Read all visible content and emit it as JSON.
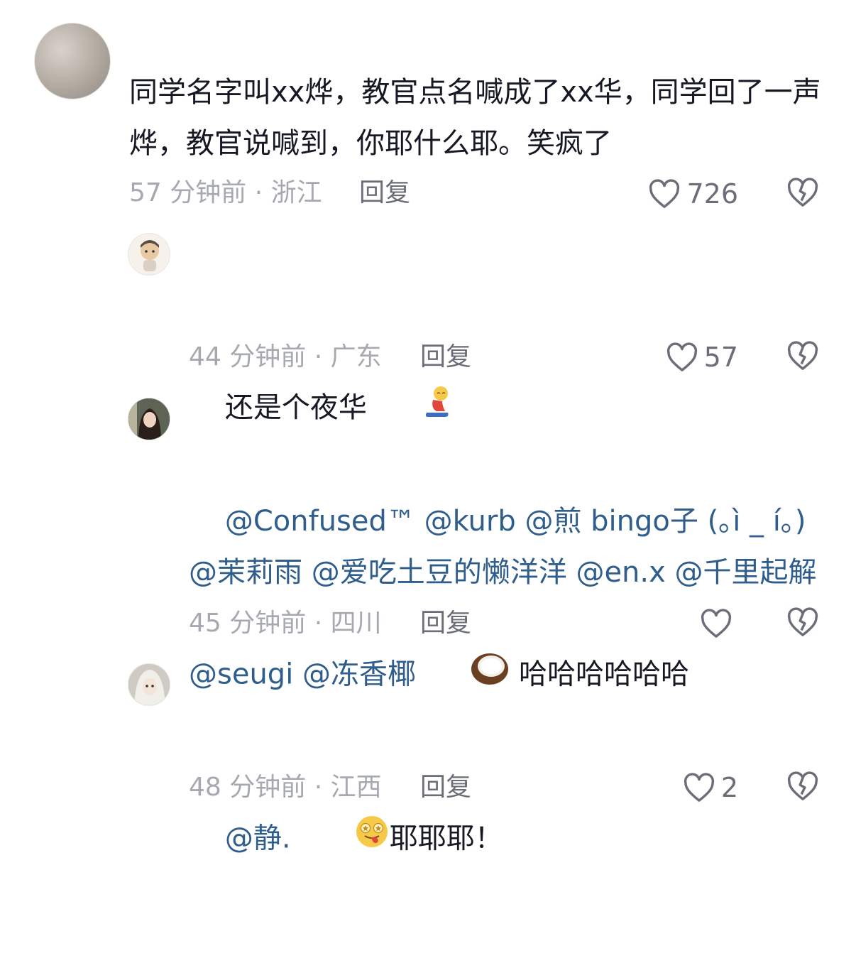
{
  "comments": [
    {
      "text": "同学名字叫xx烨，教官点名喊成了xx华，同学回了一声烨，教官说喊到，你耶什么耶。笑疯了",
      "time_location": "57 分钟前 · 浙江",
      "reply_label": "回复",
      "like_count": "726"
    },
    {
      "text": "还是个夜华",
      "time_location": "44 分钟前 · 广东",
      "reply_label": "回复",
      "like_count": "57"
    },
    {
      "mentions": [
        "@Confused™",
        "@kurb",
        "@煎 bingo子 (｡ì _ í｡)",
        "@茉莉雨",
        "@爱吃土豆的懒洋洋",
        "@en.x",
        "@千里起解",
        "@seugi",
        "@冻香椰"
      ],
      "text_suffix": "哈哈哈哈哈哈",
      "time_location": "45 分钟前 · 四川",
      "reply_label": "回复",
      "like_count": ""
    },
    {
      "mentions": [
        "@静."
      ],
      "text_suffix": "耶耶耶！",
      "time_location": "48 分钟前 · 江西",
      "reply_label": "回复",
      "like_count": "2"
    }
  ],
  "icons": {
    "like": "heart-outline-icon",
    "dislike": "broken-heart-icon",
    "emoji_1": "person-kneeling-emoji",
    "emoji_2": "coconut-emoji",
    "emoji_3": "starry-eyed-tongue-emoji"
  },
  "colors": {
    "text": "#161823",
    "mention": "#2f5e8c",
    "meta": "#a7a9b0",
    "reply": "#6b6e78"
  }
}
